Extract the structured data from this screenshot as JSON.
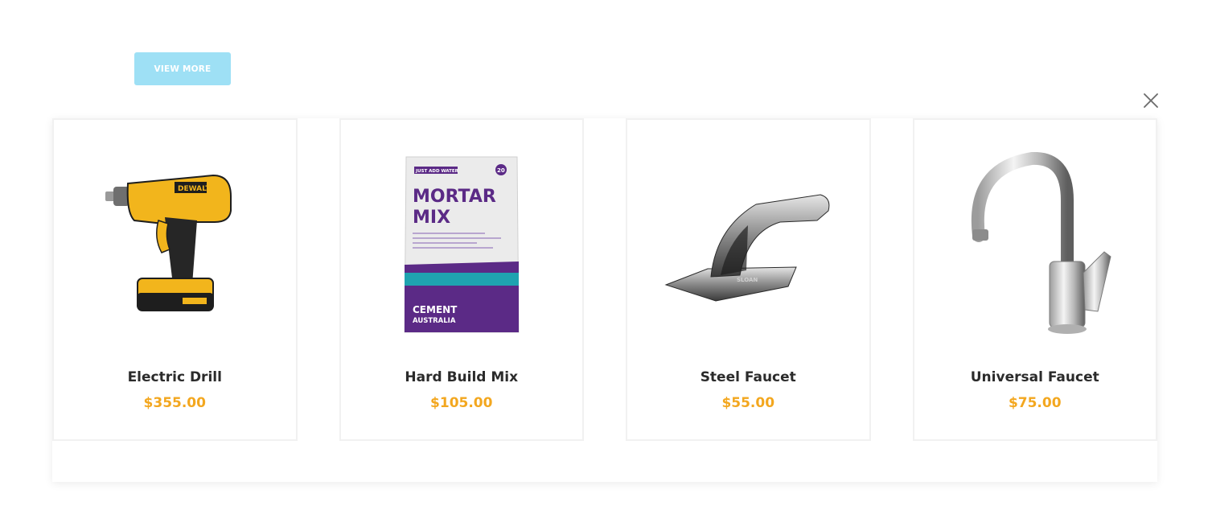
{
  "view_more_label": "VIEW MORE",
  "colors": {
    "accent_button": "#9ee0f5",
    "price": "#f3a71f",
    "name": "#2b2b2b"
  },
  "close_icon": "close-icon",
  "products": [
    {
      "name": "Electric Drill",
      "price": "$355.00",
      "image": "drill-image"
    },
    {
      "name": "Hard Build Mix",
      "price": "$105.00",
      "image": "mortar-mix-bag-image",
      "bag_lines": [
        "MORTAR",
        "MIX"
      ],
      "bag_brand": [
        "CEMENT",
        "AUSTRALIA"
      ],
      "bag_tag": "JUST ADD WATER",
      "bag_weight": "20"
    },
    {
      "name": "Steel Faucet",
      "price": "$55.00",
      "image": "sensor-faucet-image",
      "faucet_brand": "SLOAN"
    },
    {
      "name": "Universal Faucet",
      "price": "$75.00",
      "image": "chrome-faucet-image"
    }
  ]
}
